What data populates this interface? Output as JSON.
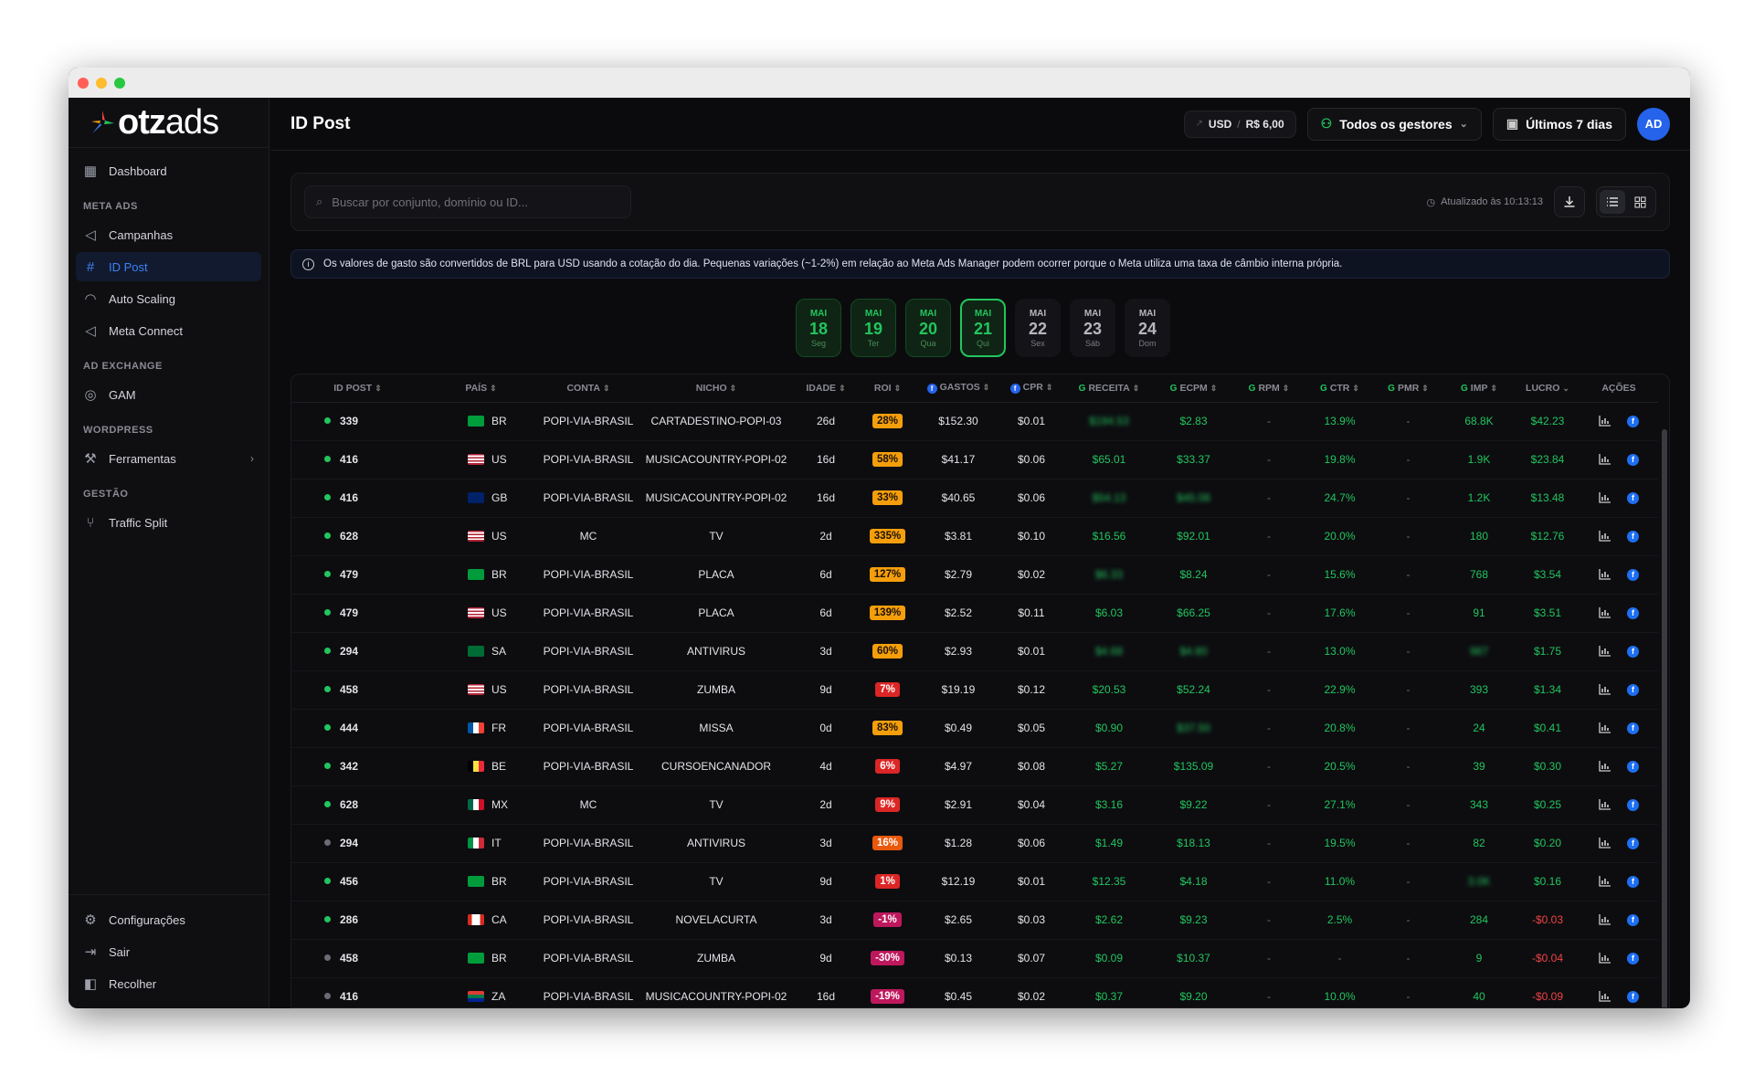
{
  "app": {
    "logo_main": "otz",
    "logo_sub": "ads"
  },
  "sidebar": {
    "dashboard": "Dashboard",
    "sections": {
      "meta_ads": "META ADS",
      "ad_exchange": "AD EXCHANGE",
      "wordpress": "WORDPRESS",
      "gestao": "GESTÃO"
    },
    "items": {
      "campanhas": "Campanhas",
      "id_post": "ID Post",
      "auto_scaling": "Auto Scaling",
      "meta_connect": "Meta Connect",
      "gam": "GAM",
      "ferramentas": "Ferramentas",
      "traffic_split": "Traffic Split"
    },
    "bottom": {
      "config": "Configurações",
      "sair": "Sair",
      "recolher": "Recolher"
    }
  },
  "header": {
    "title": "ID Post",
    "currency": "USD",
    "separator": "/",
    "rate": "R$ 6,00",
    "managers": "Todos os gestores",
    "period": "Últimos 7 dias",
    "avatar": "AD"
  },
  "toolbar": {
    "search_placeholder": "Buscar por conjunto, domínio ou ID...",
    "updated": "Atualizado às 10:13:13"
  },
  "notice": "Os valores de gasto são convertidos de BRL para USD usando a cotação do dia. Pequenas variações (~1-2%) em relação ao Meta Ads Manager podem ocorrer porque o Meta utiliza uma taxa de câmbio interna própria.",
  "days": [
    {
      "m": "MAI",
      "n": "18",
      "w": "Seg",
      "state": "done"
    },
    {
      "m": "MAI",
      "n": "19",
      "w": "Ter",
      "state": "done"
    },
    {
      "m": "MAI",
      "n": "20",
      "w": "Qua",
      "state": "done"
    },
    {
      "m": "MAI",
      "n": "21",
      "w": "Qui",
      "state": "cur"
    },
    {
      "m": "MAI",
      "n": "22",
      "w": "Sex",
      "state": "off"
    },
    {
      "m": "MAI",
      "n": "23",
      "w": "Sáb",
      "state": "off"
    },
    {
      "m": "MAI",
      "n": "24",
      "w": "Dom",
      "state": "off"
    }
  ],
  "table": {
    "headers": [
      "ID POST",
      "PAÍS",
      "CONTA",
      "NICHO",
      "IDADE",
      "ROI",
      "GASTOS",
      "CPR",
      "RECEITA",
      "ECPM",
      "RPM",
      "CTR",
      "PMR",
      "IMP",
      "LUCRO",
      "AÇÕES"
    ],
    "rows": [
      {
        "id": "339",
        "active": true,
        "cc": "BR",
        "conta": "POPI-VIA-BRASIL",
        "nicho": "CARTADESTINO-POPI-03",
        "idade": "26d",
        "roi": "28%",
        "roi_bg": "#f59e0b",
        "gastos": "$152.30",
        "cpr": "$0.01",
        "receita": "$194.53",
        "ecpm": "$2.83",
        "rpm": "-",
        "ctr": "13.9%",
        "pmr": "-",
        "imp": "68.8K",
        "lucro": "$42.23"
      },
      {
        "id": "416",
        "active": true,
        "cc": "US",
        "conta": "POPI-VIA-BRASIL",
        "nicho": "MUSICACOUNTRY-POPI-02",
        "idade": "16d",
        "roi": "58%",
        "roi_bg": "#f59e0b",
        "gastos": "$41.17",
        "cpr": "$0.06",
        "receita": "$65.01",
        "ecpm": "$33.37",
        "rpm": "-",
        "ctr": "19.8%",
        "pmr": "-",
        "imp": "1.9K",
        "lucro": "$23.84"
      },
      {
        "id": "416",
        "active": true,
        "cc": "GB",
        "conta": "POPI-VIA-BRASIL",
        "nicho": "MUSICACOUNTRY-POPI-02",
        "idade": "16d",
        "roi": "33%",
        "roi_bg": "#f59e0b",
        "gastos": "$40.65",
        "cpr": "$0.06",
        "receita": "$54.13",
        "ecpm": "$45.08",
        "rpm": "-",
        "ctr": "24.7%",
        "pmr": "-",
        "imp": "1.2K",
        "lucro": "$13.48"
      },
      {
        "id": "628",
        "active": true,
        "cc": "US",
        "conta": "MC",
        "nicho": "TV",
        "idade": "2d",
        "roi": "335%",
        "roi_bg": "#f59e0b",
        "gastos": "$3.81",
        "cpr": "$0.10",
        "receita": "$16.56",
        "ecpm": "$92.01",
        "rpm": "-",
        "ctr": "20.0%",
        "pmr": "-",
        "imp": "180",
        "lucro": "$12.76"
      },
      {
        "id": "479",
        "active": true,
        "cc": "BR",
        "conta": "POPI-VIA-BRASIL",
        "nicho": "PLACA",
        "idade": "6d",
        "roi": "127%",
        "roi_bg": "#f59e0b",
        "gastos": "$2.79",
        "cpr": "$0.02",
        "receita": "$6.33",
        "ecpm": "$8.24",
        "rpm": "-",
        "ctr": "15.6%",
        "pmr": "-",
        "imp": "768",
        "lucro": "$3.54"
      },
      {
        "id": "479",
        "active": true,
        "cc": "US",
        "conta": "POPI-VIA-BRASIL",
        "nicho": "PLACA",
        "idade": "6d",
        "roi": "139%",
        "roi_bg": "#f59e0b",
        "gastos": "$2.52",
        "cpr": "$0.11",
        "receita": "$6.03",
        "ecpm": "$66.25",
        "rpm": "-",
        "ctr": "17.6%",
        "pmr": "-",
        "imp": "91",
        "lucro": "$3.51"
      },
      {
        "id": "294",
        "active": true,
        "cc": "SA",
        "conta": "POPI-VIA-BRASIL",
        "nicho": "ANTIVIRUS",
        "idade": "3d",
        "roi": "60%",
        "roi_bg": "#f59e0b",
        "gastos": "$2.93",
        "cpr": "$0.01",
        "receita": "$4.68",
        "ecpm": "$4.80",
        "rpm": "-",
        "ctr": "13.0%",
        "pmr": "-",
        "imp": "987",
        "lucro": "$1.75"
      },
      {
        "id": "458",
        "active": true,
        "cc": "US",
        "conta": "POPI-VIA-BRASIL",
        "nicho": "ZUMBA",
        "idade": "9d",
        "roi": "7%",
        "roi_bg": "#dc2626",
        "gastos": "$19.19",
        "cpr": "$0.12",
        "receita": "$20.53",
        "ecpm": "$52.24",
        "rpm": "-",
        "ctr": "22.9%",
        "pmr": "-",
        "imp": "393",
        "lucro": "$1.34"
      },
      {
        "id": "444",
        "active": true,
        "cc": "FR",
        "conta": "POPI-VIA-BRASIL",
        "nicho": "MISSA",
        "idade": "0d",
        "roi": "83%",
        "roi_bg": "#f59e0b",
        "gastos": "$0.49",
        "cpr": "$0.05",
        "receita": "$0.90",
        "ecpm": "$37.50",
        "rpm": "-",
        "ctr": "20.8%",
        "pmr": "-",
        "imp": "24",
        "lucro": "$0.41"
      },
      {
        "id": "342",
        "active": true,
        "cc": "BE",
        "conta": "POPI-VIA-BRASIL",
        "nicho": "CURSOENCANADOR",
        "idade": "4d",
        "roi": "6%",
        "roi_bg": "#dc2626",
        "gastos": "$4.97",
        "cpr": "$0.08",
        "receita": "$5.27",
        "ecpm": "$135.09",
        "rpm": "-",
        "ctr": "20.5%",
        "pmr": "-",
        "imp": "39",
        "lucro": "$0.30"
      },
      {
        "id": "628",
        "active": true,
        "cc": "MX",
        "conta": "MC",
        "nicho": "TV",
        "idade": "2d",
        "roi": "9%",
        "roi_bg": "#dc2626",
        "gastos": "$2.91",
        "cpr": "$0.04",
        "receita": "$3.16",
        "ecpm": "$9.22",
        "rpm": "-",
        "ctr": "27.1%",
        "pmr": "-",
        "imp": "343",
        "lucro": "$0.25"
      },
      {
        "id": "294",
        "active": false,
        "cc": "IT",
        "conta": "POPI-VIA-BRASIL",
        "nicho": "ANTIVIRUS",
        "idade": "3d",
        "roi": "16%",
        "roi_bg": "#ea580c",
        "gastos": "$1.28",
        "cpr": "$0.06",
        "receita": "$1.49",
        "ecpm": "$18.13",
        "rpm": "-",
        "ctr": "19.5%",
        "pmr": "-",
        "imp": "82",
        "lucro": "$0.20"
      },
      {
        "id": "456",
        "active": true,
        "cc": "BR",
        "conta": "POPI-VIA-BRASIL",
        "nicho": "TV",
        "idade": "9d",
        "roi": "1%",
        "roi_bg": "#dc2626",
        "gastos": "$12.19",
        "cpr": "$0.01",
        "receita": "$12.35",
        "ecpm": "$4.18",
        "rpm": "-",
        "ctr": "11.0%",
        "pmr": "-",
        "imp": "3.0K",
        "lucro": "$0.16"
      },
      {
        "id": "286",
        "active": true,
        "cc": "CA",
        "conta": "POPI-VIA-BRASIL",
        "nicho": "NOVELACURTA",
        "idade": "3d",
        "roi": "-1%",
        "roi_bg": "#be185d",
        "gastos": "$2.65",
        "cpr": "$0.03",
        "receita": "$2.62",
        "ecpm": "$9.23",
        "rpm": "-",
        "ctr": "2.5%",
        "pmr": "-",
        "imp": "284",
        "lucro": "-$0.03"
      },
      {
        "id": "458",
        "active": false,
        "cc": "BR",
        "conta": "POPI-VIA-BRASIL",
        "nicho": "ZUMBA",
        "idade": "9d",
        "roi": "-30%",
        "roi_bg": "#be185d",
        "gastos": "$0.13",
        "cpr": "$0.07",
        "receita": "$0.09",
        "ecpm": "$10.37",
        "rpm": "-",
        "ctr": "-",
        "pmr": "-",
        "imp": "9",
        "lucro": "-$0.04"
      },
      {
        "id": "416",
        "active": false,
        "cc": "ZA",
        "conta": "POPI-VIA-BRASIL",
        "nicho": "MUSICACOUNTRY-POPI-02",
        "idade": "16d",
        "roi": "-19%",
        "roi_bg": "#be185d",
        "gastos": "$0.45",
        "cpr": "$0.02",
        "receita": "$0.37",
        "ecpm": "$9.20",
        "rpm": "-",
        "ctr": "10.0%",
        "pmr": "-",
        "imp": "40",
        "lucro": "-$0.09"
      }
    ]
  },
  "colors": {
    "accent": "#2563eb",
    "positive": "#22c55e",
    "negative": "#ef4444",
    "warn": "#f59e0b"
  }
}
